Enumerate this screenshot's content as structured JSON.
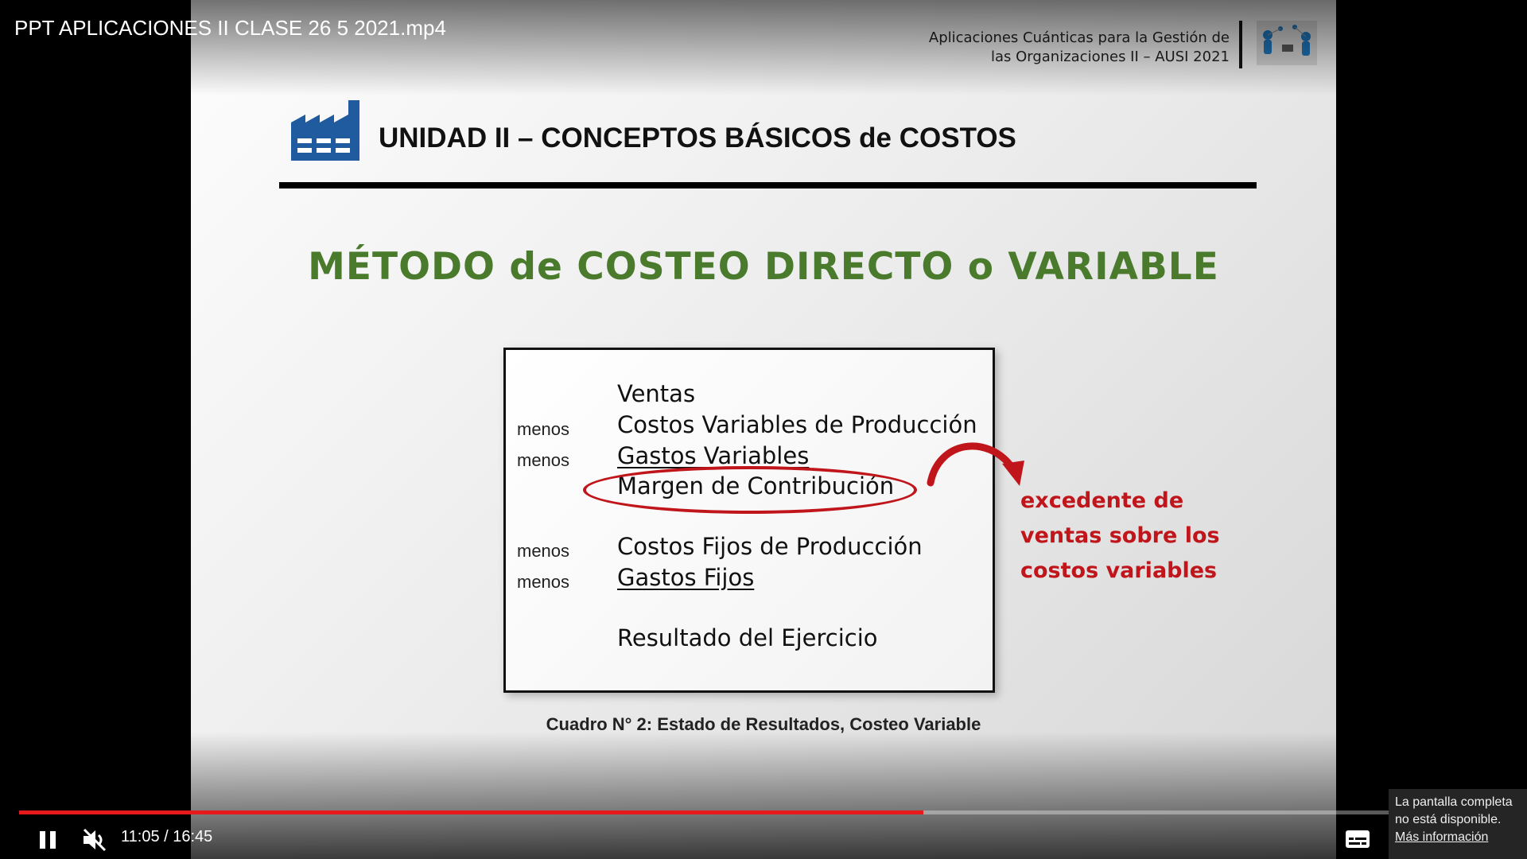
{
  "video": {
    "title": "PPT APLICACIONES II CLASE 26 5 2021.mp4"
  },
  "slide": {
    "course_title_line1": "Aplicaciones Cuánticas para la Gestión de",
    "course_title_line2": "las Organizaciones II – AUSI 2021",
    "logo_icon": "people-network-icon",
    "unit_icon": "factory-icon",
    "unit_title": "UNIDAD II – CONCEPTOS BÁSICOS de COSTOS",
    "method_title": "MÉTODO de COSTEO DIRECTO o VARIABLE",
    "income_statement": {
      "rows": [
        {
          "prefix": "",
          "label": "Ventas"
        },
        {
          "prefix": "menos",
          "label": "Costos Variables de Producción"
        },
        {
          "prefix": "menos",
          "label": "Gastos Variables"
        },
        {
          "prefix": "",
          "label": "Margen de Contribución"
        },
        {
          "prefix": "menos",
          "label": "Costos Fijos de Producción"
        },
        {
          "prefix": "menos",
          "label": "Gastos Fijos"
        },
        {
          "prefix": "",
          "label": "Resultado del Ejercicio"
        }
      ]
    },
    "annotation_lines": [
      "excedente de",
      "ventas sobre los",
      "costos variables"
    ],
    "caption": "Cuadro N° 2: Estado de Resultados, Costeo Variable",
    "colors": {
      "title_green": "#4a7a2c",
      "highlight_red": "#c0161b",
      "factory_blue": "#1f5b9e"
    }
  },
  "player": {
    "current_time": "11:05",
    "duration": "16:45",
    "time_text": "11:05 / 16:45",
    "progress": 0.66,
    "progress_color": "#e61a1a",
    "pause_icon": "pause-icon",
    "mute_icon": "muted-speaker-icon",
    "subtitles_icon": "subtitles-icon",
    "tooltip_text": "La pantalla completa no está disponible.",
    "tooltip_link": "Más información"
  }
}
